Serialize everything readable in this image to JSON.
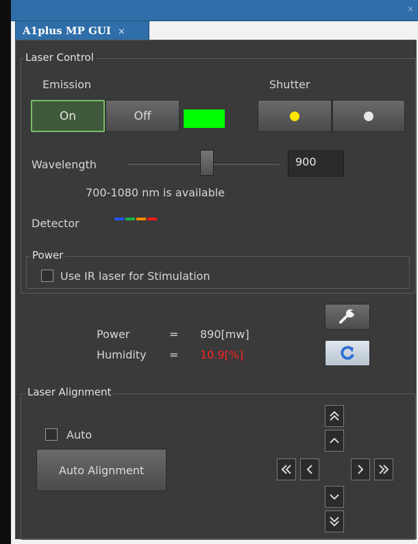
{
  "window": {
    "tab_title": "A1plus MP GUI",
    "tab_close": "×",
    "titlebar_close": "×"
  },
  "laser_control": {
    "legend": "Laser Control",
    "emission_label": "Emission",
    "on_label": "On",
    "off_label": "Off",
    "emission_indicator_color": "#00ff00",
    "shutter_label": "Shutter",
    "shutter_open_color": "#ffe600",
    "shutter_closed_color": "#e6e6e6",
    "wavelength_label": "Wavelength",
    "wavelength_value": "900",
    "wavelength_range": "700-1080 nm is available",
    "detector_label": "Detector",
    "detector_colors": [
      "#2255ff",
      "#19b34a",
      "#ff8a00",
      "#ff1a1a"
    ]
  },
  "power_group": {
    "legend": "Power",
    "ir_checkbox_label": "Use IR laser for Stimulation"
  },
  "status": {
    "power_label": "Power",
    "equals": "=",
    "power_value": "890[mw]",
    "humidity_label": "Humidity",
    "humidity_value": "10.9[%]",
    "humidity_color": "#ff2020"
  },
  "alignment": {
    "legend": "Laser Alignment",
    "auto_label": "Auto",
    "auto_alignment_button": "Auto Alignment"
  },
  "icons": {
    "wrench": "wrench-icon",
    "refresh": "refresh-icon"
  }
}
